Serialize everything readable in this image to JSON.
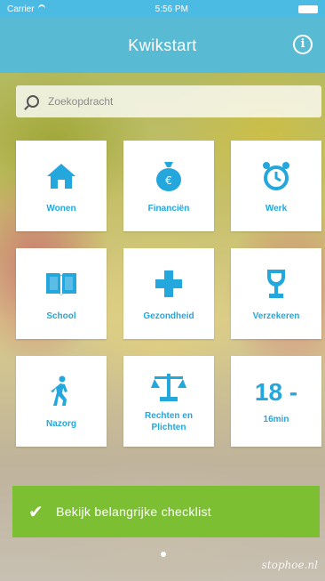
{
  "status_bar": {
    "carrier": "Carrier",
    "time": "5:56 PM"
  },
  "nav": {
    "title": "Kwikstart",
    "info": "i"
  },
  "search": {
    "placeholder": "Zoekopdracht"
  },
  "tiles": [
    {
      "label": "Wonen",
      "icon": "house-icon"
    },
    {
      "label": "Financiën",
      "icon": "money-bag-icon"
    },
    {
      "label": "Werk",
      "icon": "alarm-clock-icon"
    },
    {
      "label": "School",
      "icon": "open-book-icon"
    },
    {
      "label": "Gezondheid",
      "icon": "medical-cross-icon"
    },
    {
      "label": "Verzekeren",
      "icon": "trophy-icon"
    },
    {
      "label": "Nazorg",
      "icon": "walking-person-icon"
    },
    {
      "label": "Rechten en Plichten",
      "icon": "scales-icon"
    },
    {
      "label": "18 -",
      "sub": "16min"
    }
  ],
  "checklist": {
    "label": "Bekijk belangrijke checklist"
  },
  "watermark": "stophoe.nl",
  "colors": {
    "accent": "#24a7dc",
    "nav": "#4cbbe4",
    "checklist": "#7cbf33"
  }
}
